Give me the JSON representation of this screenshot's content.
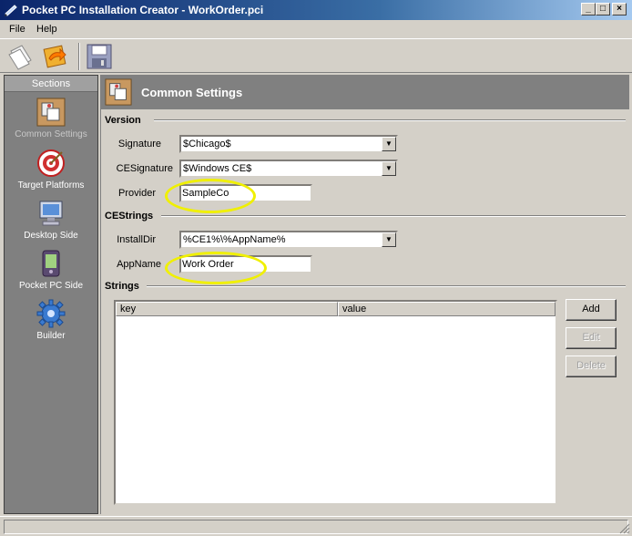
{
  "window": {
    "title": "Pocket PC Installation Creator - WorkOrder.pci",
    "min_label": "_",
    "max_label": "□",
    "close_label": "×"
  },
  "menu": {
    "file": "File",
    "help": "Help"
  },
  "toolbar": {
    "buttons": [
      "new-icon",
      "open-icon",
      "save-icon"
    ]
  },
  "sidebar": {
    "header": "Sections",
    "items": [
      {
        "label": "Common Settings",
        "icon": "common-settings-icon",
        "active": true
      },
      {
        "label": "Target Platforms",
        "icon": "target-icon"
      },
      {
        "label": "Desktop Side",
        "icon": "desktop-icon"
      },
      {
        "label": "Pocket PC Side",
        "icon": "pocket-pc-icon"
      },
      {
        "label": "Builder",
        "icon": "gear-icon"
      }
    ]
  },
  "panel": {
    "title": "Common Settings"
  },
  "version": {
    "section": "Version",
    "signature_label": "Signature",
    "signature_value": "$Chicago$",
    "cesignature_label": "CESignature",
    "cesignature_value": "$Windows CE$",
    "provider_label": "Provider",
    "provider_value": "SampleCo"
  },
  "cestrings": {
    "section": "CEStrings",
    "installdir_label": "InstallDir",
    "installdir_value": "%CE1%\\%AppName%",
    "appname_label": "AppName",
    "appname_value": "Work Order"
  },
  "strings": {
    "section": "Strings",
    "columns": [
      "key",
      "value"
    ],
    "rows": [],
    "add_label": "Add",
    "edit_label": "Edit",
    "delete_label": "Delete"
  },
  "colors": {
    "highlight": "#f0f000",
    "titlebar": "#0a246a",
    "sidebar": "#808080"
  }
}
